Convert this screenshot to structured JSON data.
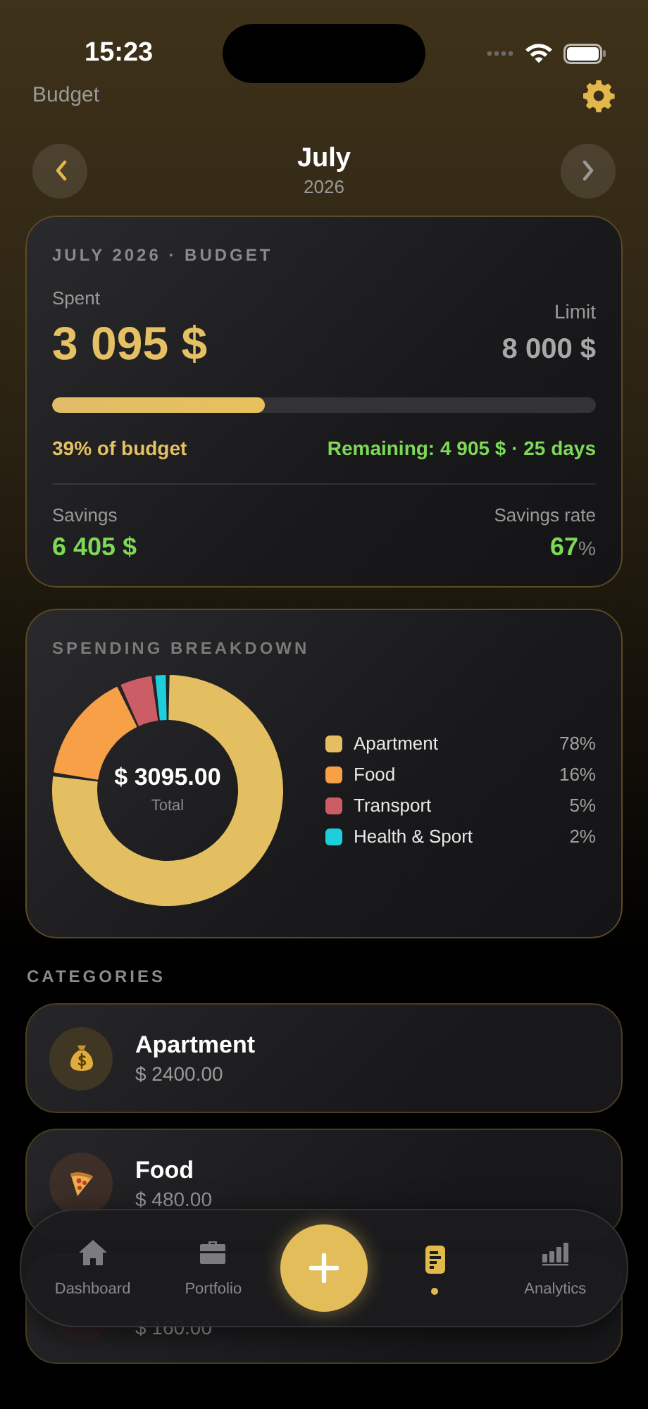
{
  "status_bar": {
    "time": "15:23"
  },
  "header": {
    "title": "Budget"
  },
  "month_nav": {
    "month": "July",
    "year": "2026"
  },
  "budget_card": {
    "heading": "JULY 2026 · BUDGET",
    "spent_label": "Spent",
    "spent": "3 095 $",
    "limit_label": "Limit",
    "limit": "8 000 $",
    "level": 0.39,
    "percent_text": "39% of budget",
    "remaining_text": "Remaining: 4 905 $ · 25 days",
    "savings_label": "Savings",
    "savings": "6 405 $",
    "rate_label": "Savings rate",
    "rate": "67",
    "rate_unit": "%"
  },
  "breakdown_card": {
    "heading": "SPENDING BREAKDOWN",
    "total": "$ 3095.00",
    "total_label": "Total",
    "chart_data": {
      "type": "donut",
      "categories": [
        "Apartment",
        "Food",
        "Transport",
        "Health & Sport"
      ],
      "values": [
        78,
        16,
        5,
        2
      ]
    },
    "legend": [
      {
        "percent": "78%",
        "color": "#e3bf62"
      },
      {
        "percent": "16%",
        "color": "#f7a047"
      },
      {
        "percent": "5%",
        "color": "#cc5d66"
      },
      {
        "percent": "2%",
        "color": "#1dcfdc"
      }
    ]
  },
  "categories_heading": "CATEGORIES",
  "categories": [
    {
      "kind": "money",
      "name": "Apartment",
      "amount": "$ 2400.00"
    },
    {
      "kind": "pizza",
      "name": "Food",
      "amount": "$ 480.00"
    },
    {
      "kind": "hidden",
      "amount": "$ 160.00"
    }
  ],
  "tab_bar": [
    {
      "kind": "tab",
      "label": "Dashboard",
      "selected": false
    },
    {
      "kind": "tab",
      "label": "Portfolio",
      "selected": false
    },
    {
      "kind": "add"
    },
    {
      "kind": "tab",
      "selected": true
    },
    {
      "kind": "tab",
      "label": "Analytics",
      "selected": false
    }
  ]
}
